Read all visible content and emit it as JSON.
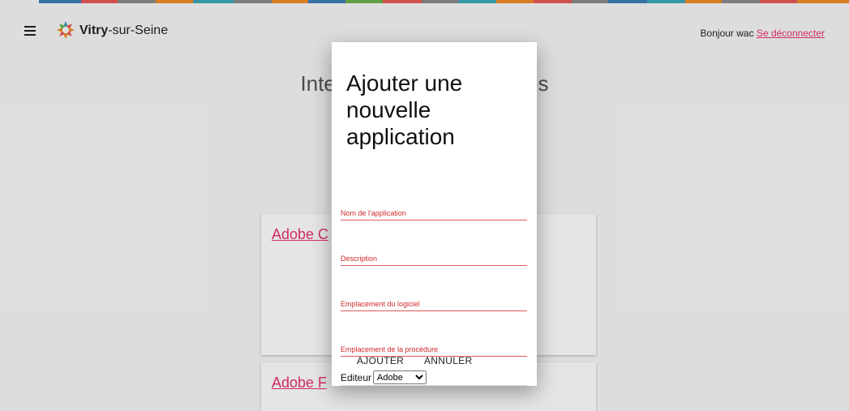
{
  "header": {
    "brand_bold": "Vitry",
    "brand_rest": "-sur-Seine",
    "greeting": "Bonjour wac",
    "logout_label": "Se déconnecter"
  },
  "page": {
    "title_partial": "Inter",
    "title_partial_end": "des"
  },
  "cards": [
    {
      "link_label": "Adobe C"
    },
    {
      "link_label": "Adobe F"
    }
  ],
  "modal": {
    "title": "Ajouter une nouvelle application",
    "fields": {
      "name_label": "Nom de l'application",
      "description_label": "Description",
      "software_location_label": "Emplacement du logiciel",
      "procedure_location_label": "Emplacement de la procédure"
    },
    "editor_label": "Editeur",
    "editor_selected": "Adobe",
    "add_button": "AJOUTER",
    "cancel_button": "ANNULER"
  },
  "colors": {
    "accent": "#e8336b",
    "field_underline": "#e05a5a"
  },
  "icons": [
    "menu-icon",
    "vitry-logo-icon",
    "chevron-down-icon"
  ]
}
